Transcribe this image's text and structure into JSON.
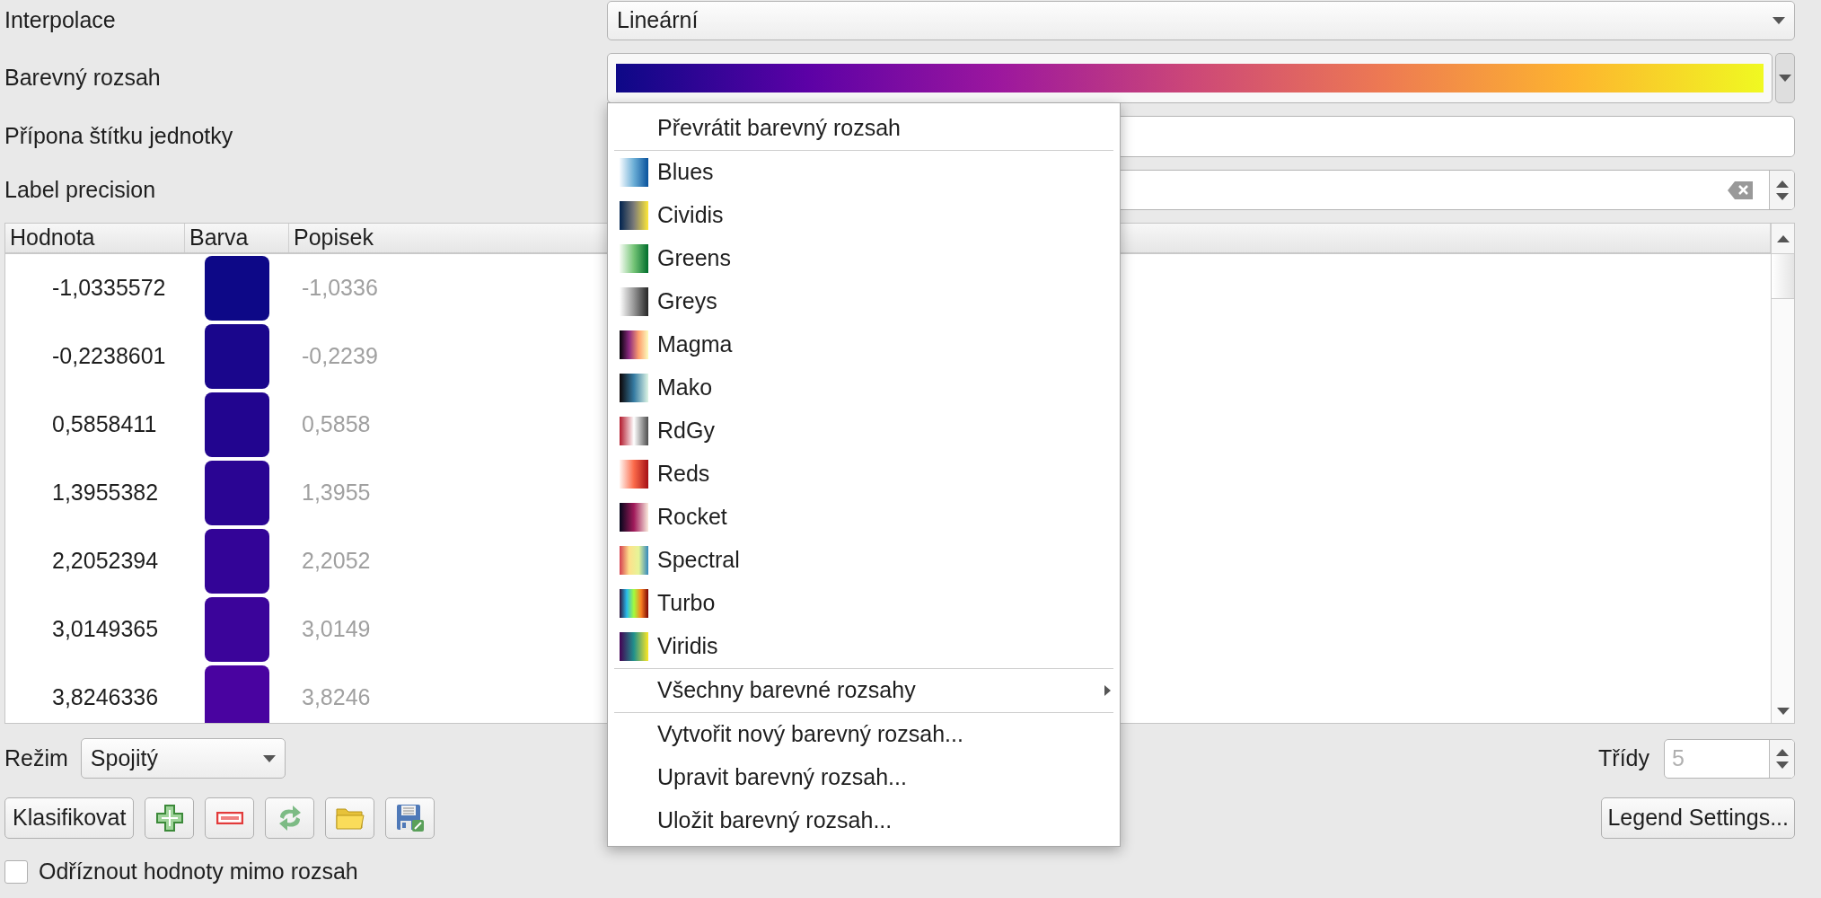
{
  "form": [
    {
      "kind": "combo",
      "label": "Interpolace",
      "value": "Lineární"
    },
    {
      "kind": "ramp",
      "label": "Barevný rozsah"
    },
    {
      "kind": "text",
      "label": "Přípona štítku jednotky"
    },
    {
      "kind": "spin",
      "label": "Label precision"
    }
  ],
  "table": {
    "columns": [
      "Hodnota",
      "Barva",
      "Popisek"
    ],
    "rows": [
      {
        "value": "-1,0335572",
        "color": "#0d0887",
        "label": "-1,0336"
      },
      {
        "value": "-0,2238601",
        "color": "#1a068c",
        "label": "-0,2239"
      },
      {
        "value": "0,5858411",
        "color": "#22058f",
        "label": "0,5858"
      },
      {
        "value": "1,3955382",
        "color": "#2a0593",
        "label": "1,3955"
      },
      {
        "value": "2,2052394",
        "color": "#330497",
        "label": "2,2052"
      },
      {
        "value": "3,0149365",
        "color": "#3b049a",
        "label": "3,0149"
      },
      {
        "value": "3,8246336",
        "color": "#4903a0",
        "label": "3,8246"
      }
    ]
  },
  "mode": {
    "label": "Režim",
    "value": "Spojitý"
  },
  "classes": {
    "label": "Třídy",
    "value": "5",
    "disabled": true
  },
  "buttons": [
    {
      "kind": "text",
      "label": "Klasifikovat"
    },
    {
      "kind": "add"
    },
    {
      "kind": "remove"
    },
    {
      "kind": "swap"
    },
    {
      "kind": "open"
    },
    {
      "kind": "save"
    }
  ],
  "legend_button": "Legend Settings...",
  "clip": {
    "label": "Odříznout hodnoty mimo rozsah",
    "checked": false
  },
  "menu": {
    "sections": [
      [
        {
          "kind": "action",
          "label": "Převrátit barevný rozsah"
        }
      ],
      [
        {
          "kind": "ramp",
          "label": "Blues"
        },
        {
          "kind": "ramp",
          "label": "Cividis"
        },
        {
          "kind": "ramp",
          "label": "Greens"
        },
        {
          "kind": "ramp",
          "label": "Greys"
        },
        {
          "kind": "ramp",
          "label": "Magma"
        },
        {
          "kind": "ramp",
          "label": "Mako"
        },
        {
          "kind": "ramp",
          "label": "RdGy"
        },
        {
          "kind": "ramp",
          "label": "Reds"
        },
        {
          "kind": "ramp",
          "label": "Rocket"
        },
        {
          "kind": "ramp",
          "label": "Spectral"
        },
        {
          "kind": "ramp",
          "label": "Turbo"
        },
        {
          "kind": "ramp",
          "label": "Viridis"
        }
      ],
      [
        {
          "kind": "submenu",
          "label": "Všechny barevné rozsahy"
        }
      ],
      [
        {
          "kind": "action",
          "label": "Vytvořit nový barevný rozsah..."
        },
        {
          "kind": "action",
          "label": "Upravit barevný rozsah..."
        },
        {
          "kind": "action",
          "label": "Uložit barevný rozsah..."
        }
      ]
    ]
  }
}
